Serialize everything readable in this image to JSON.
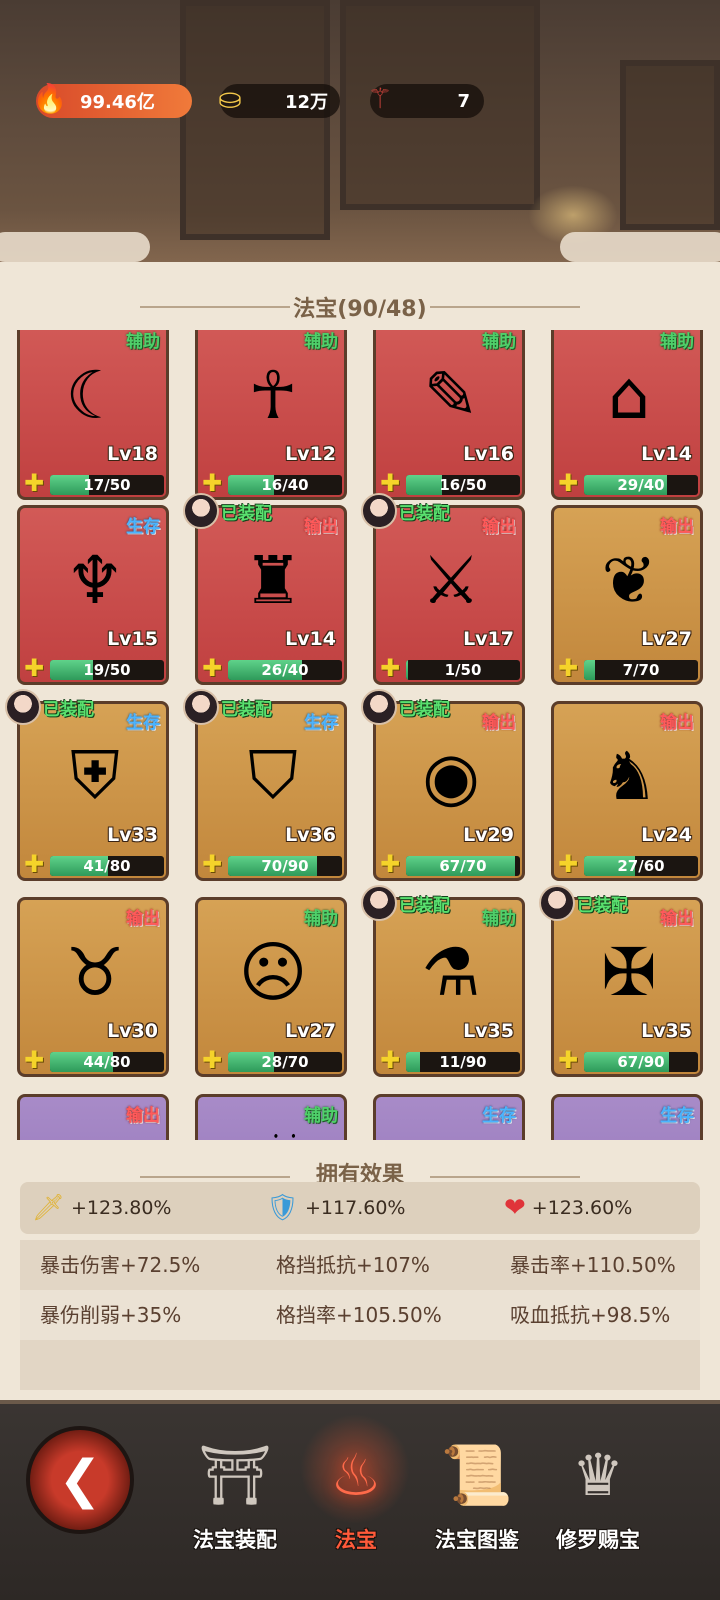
{
  "resources": {
    "fire": {
      "value": "99.46亿",
      "icon": "flame-icon",
      "color": "#e85a2a"
    },
    "gold": {
      "value": "12万",
      "icon": "gold-ingot-icon"
    },
    "token": {
      "value": "7",
      "icon": "incense-sticks-icon"
    }
  },
  "section_title": "法宝(90/48)",
  "cards": [
    {
      "tag": "辅助",
      "tag_type": "sup",
      "level": "Lv18",
      "progress": "17/50",
      "fill": 0.34,
      "rarity": "red",
      "art": "☾"
    },
    {
      "tag": "辅助",
      "tag_type": "sup",
      "level": "Lv12",
      "progress": "16/40",
      "fill": 0.4,
      "rarity": "red",
      "art": "☥"
    },
    {
      "tag": "辅助",
      "tag_type": "sup",
      "level": "Lv16",
      "progress": "16/50",
      "fill": 0.32,
      "rarity": "red",
      "art": "✎"
    },
    {
      "tag": "辅助",
      "tag_type": "sup",
      "level": "Lv14",
      "progress": "29/40",
      "fill": 0.725,
      "rarity": "red",
      "art": "⌂"
    },
    {
      "tag": "生存",
      "tag_type": "sur",
      "level": "Lv15",
      "progress": "19/50",
      "fill": 0.38,
      "rarity": "red",
      "art": "♆"
    },
    {
      "tag": "输出",
      "tag_type": "out",
      "level": "Lv14",
      "progress": "26/40",
      "fill": 0.65,
      "rarity": "red",
      "art": "♜",
      "equipped": "已装配"
    },
    {
      "tag": "输出",
      "tag_type": "out",
      "level": "Lv17",
      "progress": "1/50",
      "fill": 0.02,
      "rarity": "red",
      "art": "⚔",
      "equipped": "已装配"
    },
    {
      "tag": "输出",
      "tag_type": "out",
      "level": "Lv27",
      "progress": "7/70",
      "fill": 0.1,
      "rarity": "orange",
      "art": "❦"
    },
    {
      "tag": "生存",
      "tag_type": "sur",
      "level": "Lv33",
      "progress": "41/80",
      "fill": 0.5125,
      "rarity": "orange",
      "art": "⛨",
      "equipped": "已装配"
    },
    {
      "tag": "生存",
      "tag_type": "sur",
      "level": "Lv36",
      "progress": "70/90",
      "fill": 0.78,
      "rarity": "orange",
      "art": "⛉",
      "equipped": "已装配"
    },
    {
      "tag": "输出",
      "tag_type": "out",
      "level": "Lv29",
      "progress": "67/70",
      "fill": 0.957,
      "rarity": "orange",
      "art": "◉",
      "equipped": "已装配"
    },
    {
      "tag": "输出",
      "tag_type": "out",
      "level": "Lv24",
      "progress": "27/60",
      "fill": 0.45,
      "rarity": "orange",
      "art": "♞"
    },
    {
      "tag": "输出",
      "tag_type": "out",
      "level": "Lv30",
      "progress": "44/80",
      "fill": 0.55,
      "rarity": "orange",
      "art": "♉"
    },
    {
      "tag": "辅助",
      "tag_type": "sup",
      "level": "Lv27",
      "progress": "28/70",
      "fill": 0.4,
      "rarity": "orange",
      "art": "☹"
    },
    {
      "tag": "辅助",
      "tag_type": "sup",
      "level": "Lv35",
      "progress": "11/90",
      "fill": 0.122,
      "rarity": "orange",
      "art": "⚗",
      "equipped": "已装配"
    },
    {
      "tag": "输出",
      "tag_type": "out",
      "level": "Lv35",
      "progress": "67/90",
      "fill": 0.744,
      "rarity": "orange",
      "art": "✠",
      "equipped": "已装配"
    },
    {
      "tag": "输出",
      "tag_type": "out",
      "level": "",
      "progress": "",
      "fill": 0,
      "rarity": "purple",
      "art": "✦"
    },
    {
      "tag": "辅助",
      "tag_type": "sup",
      "level": "",
      "progress": "",
      "fill": 0,
      "rarity": "purple",
      "art": "☄"
    },
    {
      "tag": "生存",
      "tag_type": "sur",
      "level": "",
      "progress": "",
      "fill": 0,
      "rarity": "purple",
      "art": "☗"
    },
    {
      "tag": "生存",
      "tag_type": "sur",
      "level": "",
      "progress": "",
      "fill": 0,
      "rarity": "purple",
      "art": "☘"
    }
  ],
  "effects": {
    "title": "拥有效果",
    "stats": [
      {
        "icon": "sword-icon",
        "glyph": "🗡",
        "value": "+123.80%"
      },
      {
        "icon": "shield-icon",
        "glyph": "🛡",
        "value": "+117.60%"
      },
      {
        "icon": "heart-icon",
        "glyph": "❤",
        "value": "+123.60%"
      }
    ],
    "attrs": [
      [
        "暴击伤害+72.5%",
        "格挡抵抗+107%",
        "暴击率+110.50%"
      ],
      [
        "暴伤削弱+35%",
        "格挡率+105.50%",
        "吸血抵抗+98.5%"
      ],
      [
        "",
        "",
        ""
      ]
    ]
  },
  "nav": {
    "back_icon": "back-emblem-icon",
    "items": [
      {
        "label": "法宝装配",
        "icon": "temple-icon",
        "glyph": "⛩",
        "active": false
      },
      {
        "label": "法宝",
        "icon": "flame-swirl-icon",
        "glyph": "♨",
        "active": true
      },
      {
        "label": "法宝图鉴",
        "icon": "scroll-book-icon",
        "glyph": "📜",
        "active": false
      },
      {
        "label": "修罗赐宝",
        "icon": "asura-statue-icon",
        "glyph": "♛",
        "active": false
      }
    ]
  }
}
